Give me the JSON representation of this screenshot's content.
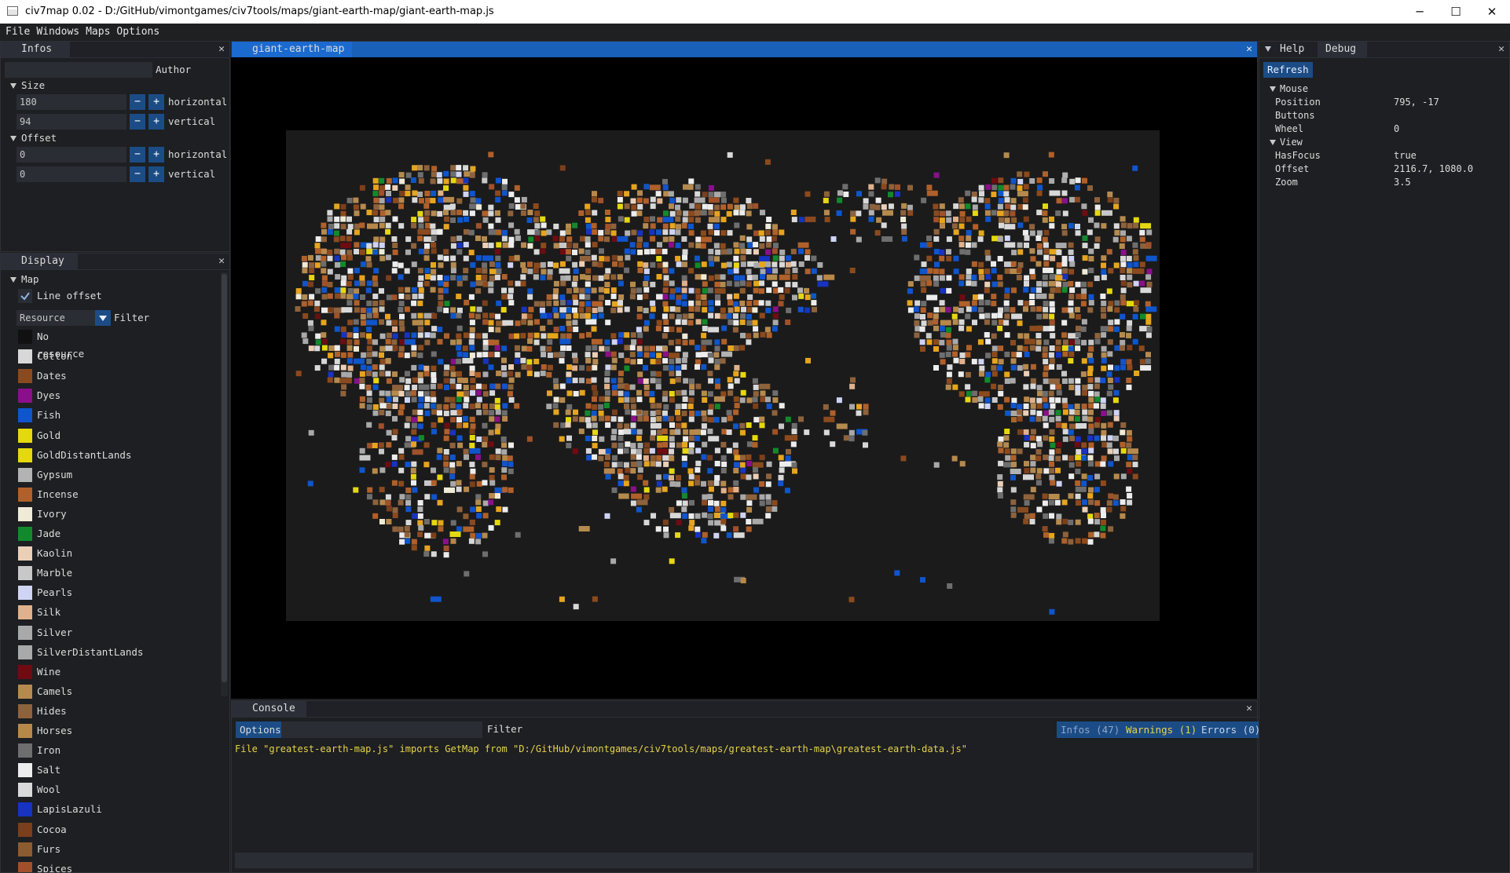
{
  "window": {
    "title": "civ7map 0.02 - D:/GitHub/vimontgames/civ7tools/maps/giant-earth-map/giant-earth-map.js",
    "minimize_icon": "─",
    "maximize_icon": "☐",
    "close_icon": "✕"
  },
  "menu": [
    "File",
    "Windows",
    "Maps",
    "Options"
  ],
  "infos": {
    "tab": "Infos",
    "author_value": "",
    "author_label": "Author",
    "size_header": "Size",
    "width_value": "180",
    "width_label": "horizontal",
    "height_value": "94",
    "height_label": "vertical",
    "offset_header": "Offset",
    "offset_h_value": "0",
    "offset_h_label": "horizontal",
    "offset_v_value": "0",
    "offset_v_label": "vertical",
    "minus": "−",
    "plus": "+"
  },
  "display": {
    "tab": "Display",
    "map_header": "Map",
    "line_offset_label": "Line offset",
    "line_offset_checked": true,
    "combo_value": "Resource",
    "filter_label": "Filter",
    "resources": [
      {
        "name": "No resource",
        "color": "#111111"
      },
      {
        "name": "Cotton",
        "color": "#d8d8d8"
      },
      {
        "name": "Dates",
        "color": "#8b4a1e"
      },
      {
        "name": "Dyes",
        "color": "#8a0f8a"
      },
      {
        "name": "Fish",
        "color": "#0f55cc"
      },
      {
        "name": "Gold",
        "color": "#e6d80f"
      },
      {
        "name": "GoldDistantLands",
        "color": "#e6d80f"
      },
      {
        "name": "Gypsum",
        "color": "#b3b3b3"
      },
      {
        "name": "Incense",
        "color": "#b0602a"
      },
      {
        "name": "Ivory",
        "color": "#f0ebd7"
      },
      {
        "name": "Jade",
        "color": "#128a2c"
      },
      {
        "name": "Kaolin",
        "color": "#ebcfb7"
      },
      {
        "name": "Marble",
        "color": "#c8c8c8"
      },
      {
        "name": "Pearls",
        "color": "#cfd4f5"
      },
      {
        "name": "Silk",
        "color": "#e0b18c"
      },
      {
        "name": "Silver",
        "color": "#a9a9a9"
      },
      {
        "name": "SilverDistantLands",
        "color": "#a9a9a9"
      },
      {
        "name": "Wine",
        "color": "#6e0c12"
      },
      {
        "name": "Camels",
        "color": "#b58a4f"
      },
      {
        "name": "Hides",
        "color": "#8e623c"
      },
      {
        "name": "Horses",
        "color": "#b8884a"
      },
      {
        "name": "Iron",
        "color": "#6e6e6e"
      },
      {
        "name": "Salt",
        "color": "#ededed"
      },
      {
        "name": "Wool",
        "color": "#d9d9d9"
      },
      {
        "name": "LapisLazuli",
        "color": "#1633c2"
      },
      {
        "name": "Cocoa",
        "color": "#7b3f1c"
      },
      {
        "name": "Furs",
        "color": "#8c5b30"
      },
      {
        "name": "Spices",
        "color": "#a0512a"
      }
    ]
  },
  "map": {
    "tab": "giant-earth-map",
    "grid": {
      "columns": 180,
      "rows": 94
    }
  },
  "console": {
    "tab": "Console",
    "options_button": "Options",
    "filter_value": "",
    "filter_label": "Filter",
    "infos_chip": "Infos (47)",
    "warnings_chip": "Warnings (1)",
    "errors_chip": "Errors (0)",
    "message": "File \"greatest-earth-map.js\" imports GetMap from \"D:/GitHub/vimontgames/civ7tools/maps/greatest-earth-map\\greatest-earth-data.js\"",
    "input_value": ""
  },
  "help": {
    "tab_help": "Help",
    "tab_debug": "Debug",
    "refresh": "Refresh",
    "mouse_header": "Mouse",
    "view_header": "View",
    "mouse": [
      {
        "key": "Position",
        "value": "795, -17"
      },
      {
        "key": "Buttons",
        "value": ""
      },
      {
        "key": "Wheel",
        "value": "0"
      }
    ],
    "view": [
      {
        "key": "HasFocus",
        "value": "true"
      },
      {
        "key": "Offset",
        "value": "2116.7, 1080.0"
      },
      {
        "key": "Zoom",
        "value": "3.5"
      }
    ]
  },
  "colors": {
    "accent": "#1c4c86",
    "active_tab": "#1960b8",
    "warning_text": "#e6d34a",
    "map_background": "#1b1b1b"
  }
}
